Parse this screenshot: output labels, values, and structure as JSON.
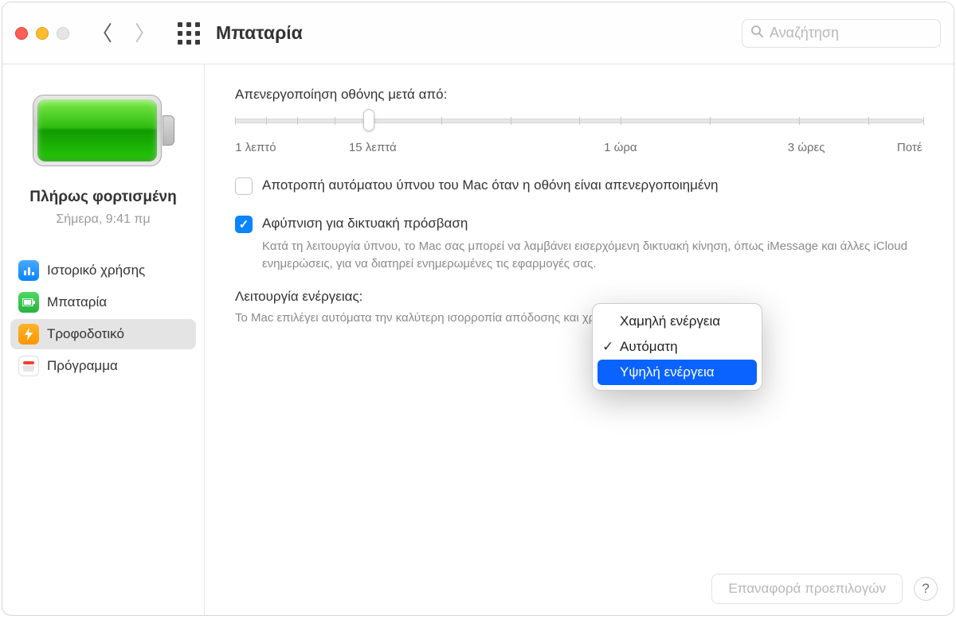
{
  "window": {
    "title": "Μπαταρία"
  },
  "search": {
    "placeholder": "Αναζήτηση"
  },
  "sidebar": {
    "status_title": "Πλήρως φορτισμένη",
    "status_sub": "Σήμερα,  9:41 πμ",
    "items": [
      {
        "label": "Ιστορικό χρήσης"
      },
      {
        "label": "Μπαταρία"
      },
      {
        "label": "Τροφοδοτικό"
      },
      {
        "label": "Πρόγραμμα"
      }
    ]
  },
  "main": {
    "slider_title": "Απενεργοποίηση οθόνης μετά από:",
    "slider_labels": {
      "l1": "1 λεπτό",
      "l15": "15 λεπτά",
      "l1h": "1 ώρα",
      "l3h": "3 ώρες",
      "never": "Ποτέ"
    },
    "check1": {
      "label": "Αποτροπή αυτόματου ύπνου του Mac όταν η οθόνη είναι απενεργοποιημένη"
    },
    "check2": {
      "label": "Αφύπνιση για δικτυακή πρόσβαση",
      "desc": "Κατά τη λειτουργία ύπνου, το Mac σας μπορεί να λαμβάνει εισερχόμενη δικτυακή κίνηση, όπως iMessage και άλλες iCloud ενημερώσεις, για να διατηρεί ενημερωμένες τις εφαρμογές σας."
    },
    "mode": {
      "label": "Λειτουργία ενέργειας:",
      "desc": "Το Mac επιλέγει αυτόματα την καλύτερη ισορροπία απόδοσης και χρήσης ενέργειας."
    },
    "popup": {
      "opt_low": "Χαμηλή ενέργεια",
      "opt_auto": "Αυτόματη",
      "opt_high": "Υψηλή ενέργεια"
    },
    "reset": "Επαναφορά προεπιλογών"
  }
}
